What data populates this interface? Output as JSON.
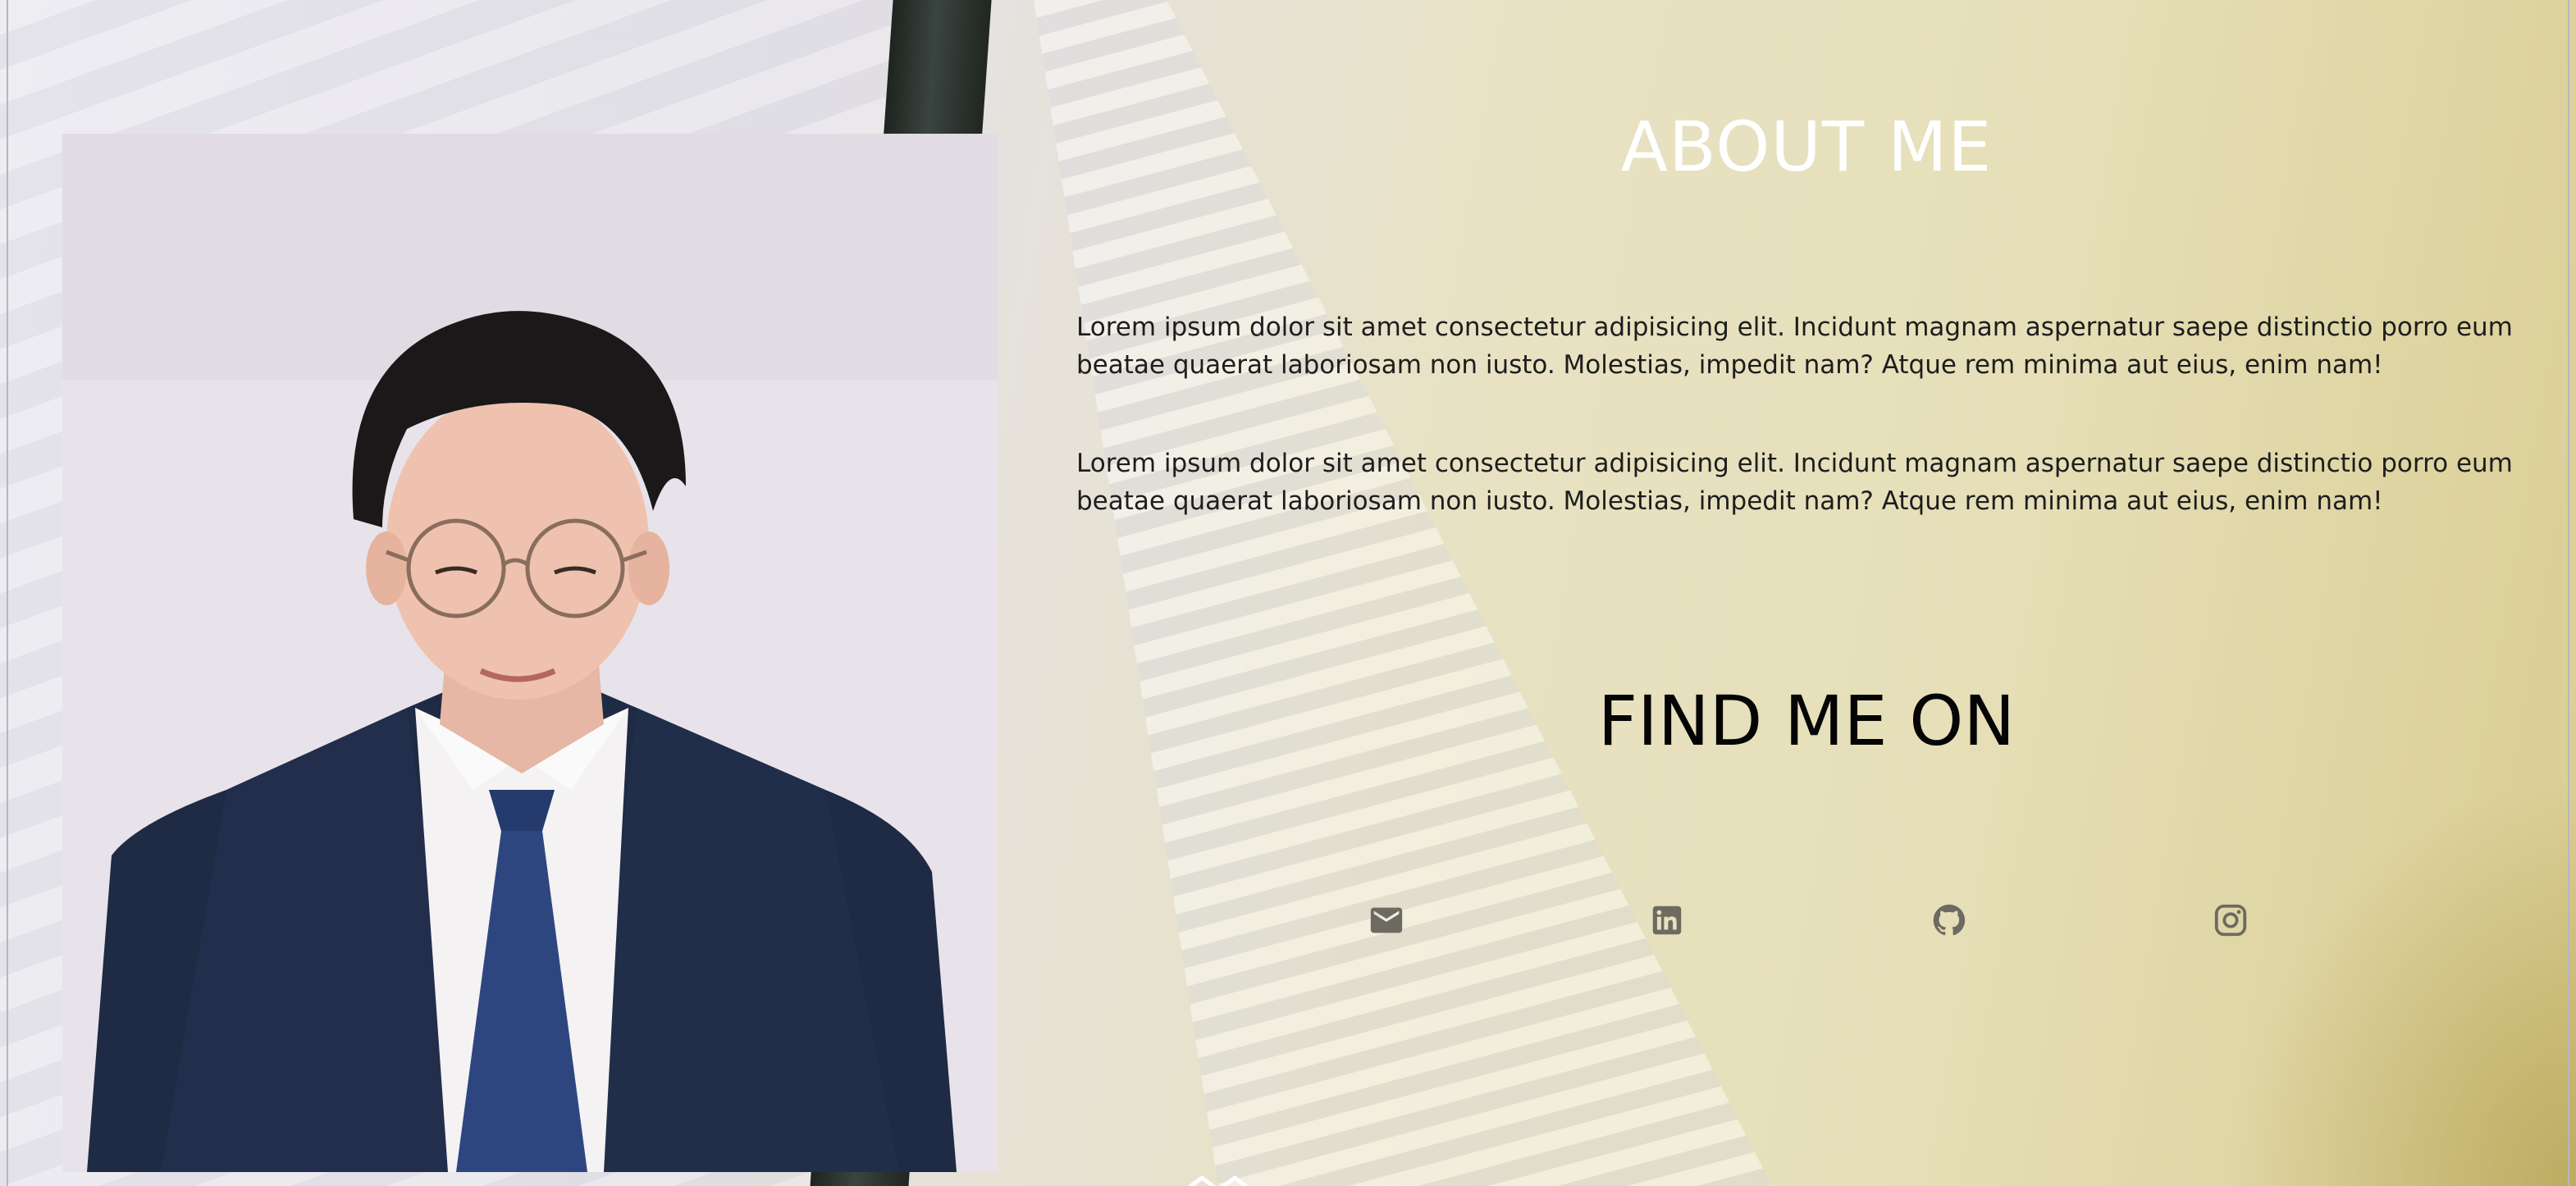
{
  "about": {
    "title": "ABOUT ME",
    "paragraph_1": "Lorem ipsum dolor sit amet consectetur adipisicing elit. Incidunt magnam aspernatur saepe distinctio porro eum beatae quaerat laboriosam non iusto. Molestias, impedit nam? Atque rem minima aut eius, enim nam!",
    "paragraph_2": "Lorem ipsum dolor sit amet consectetur adipisicing elit. Incidunt magnam aspernatur saepe distinctio porro eum beatae quaerat laboriosam non iusto. Molestias, impedit nam? Atque rem minima aut eius, enim nam!"
  },
  "find_me": {
    "title": "FIND ME ON",
    "links": [
      {
        "icon": "email-icon"
      },
      {
        "icon": "linkedin-icon"
      },
      {
        "icon": "github-icon"
      },
      {
        "icon": "instagram-icon"
      }
    ]
  },
  "colors": {
    "about_title": "#ffffff",
    "find_title": "#050505",
    "body_text": "#1d1d1d",
    "icon": "#6d6a62"
  }
}
